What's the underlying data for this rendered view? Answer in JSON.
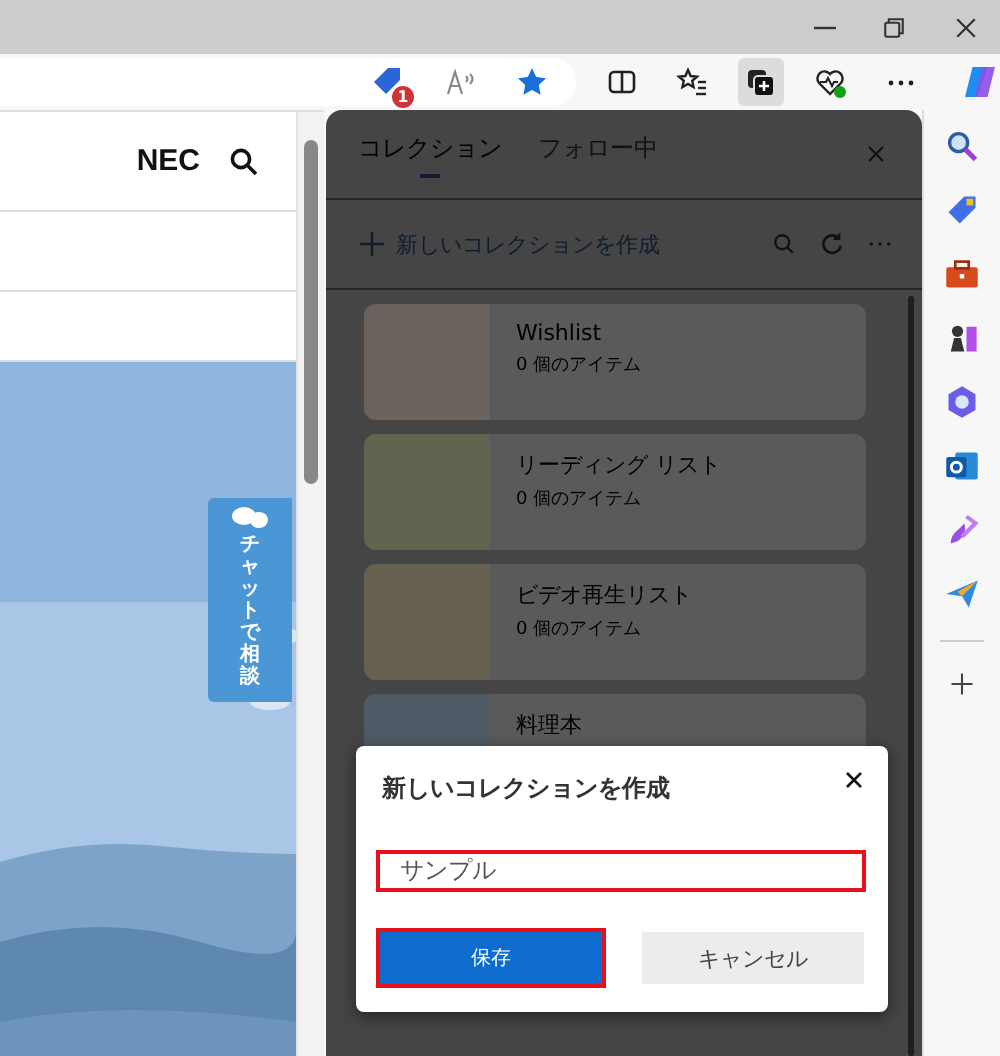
{
  "address_bar": {
    "shopping_badge": "1"
  },
  "toolbar": {
    "buttons": [
      {
        "kind": "split",
        "selected": false
      },
      {
        "kind": "favorites",
        "selected": false
      },
      {
        "kind": "collections",
        "selected": true
      },
      {
        "kind": "health",
        "selected": false
      },
      {
        "kind": "more",
        "selected": false
      }
    ]
  },
  "page": {
    "logo": "NEC",
    "chat_button": "チャットで相談"
  },
  "collections": {
    "tabs": [
      {
        "label": "コレクション",
        "selected": true
      },
      {
        "label": "フォロー中",
        "selected": false
      }
    ],
    "create_label": "新しいコレクションを作成",
    "items": [
      {
        "title": "Wishlist",
        "count": "0 個のアイテム",
        "color": "#6b625c"
      },
      {
        "title": "リーディング リスト",
        "count": "0 個のアイテム",
        "color": "#62644f"
      },
      {
        "title": "ビデオ再生リスト",
        "count": "0 個のアイテム",
        "color": "#66604f"
      },
      {
        "title": "料理本",
        "color": "#4f5a66"
      }
    ]
  },
  "dialog": {
    "title": "新しいコレクションを作成",
    "input": {
      "value": "サンプル",
      "highlighted": true
    },
    "save": {
      "label": "保存",
      "highlighted": true
    },
    "cancel": "キャンセル"
  }
}
